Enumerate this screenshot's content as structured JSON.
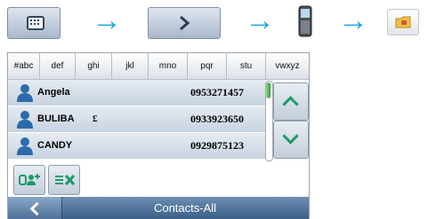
{
  "instruction_arrows": [
    "→",
    "→",
    "→"
  ],
  "keyboard": {
    "tabs": [
      "#abc",
      "def",
      "ghi",
      "jkl",
      "mno",
      "pqr",
      "stu",
      "vwxyz"
    ]
  },
  "contacts": [
    {
      "name": "Angela",
      "symbol": "",
      "number": "0953271457"
    },
    {
      "name": "BULIBA",
      "symbol": "£",
      "number": "0933923650"
    },
    {
      "name": "CANDY",
      "symbol": "",
      "number": "0929875123"
    }
  ],
  "scroll": {
    "position_fraction": 0.05
  },
  "bottom_bar": {
    "title": "Contacts-All"
  },
  "colors": {
    "accent_arrow": "#1aa7df",
    "bar": "#3c5f88",
    "row": "#c7d3e1"
  }
}
